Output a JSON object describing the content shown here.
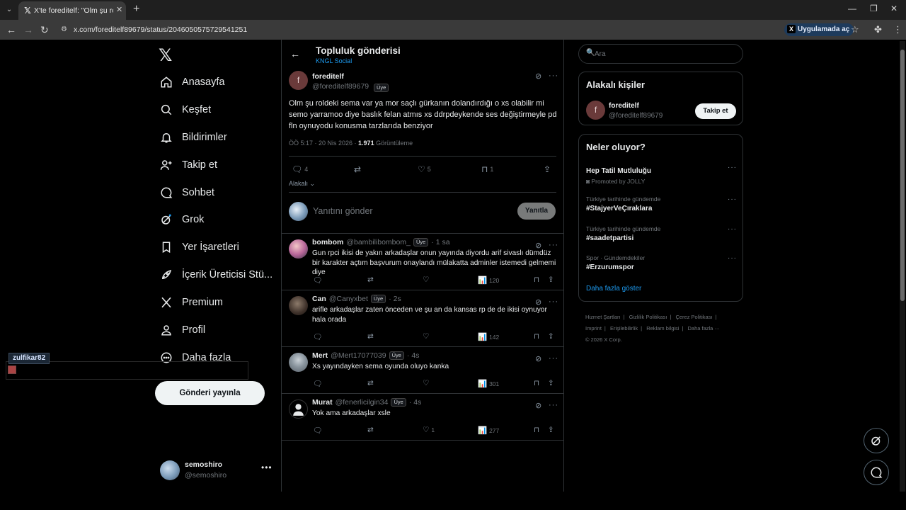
{
  "browser": {
    "tab_title": "X'te foreditelf: \"Olm şu roldeki sema var ya mor saçlı gürkanın dolandırdığı o xs olabilir mi",
    "url": "x.com/foreditelf89679/status/2046050575729541251",
    "open_in_app": "Uygulamada aç"
  },
  "nav": {
    "items": [
      {
        "label": "Anasayfa",
        "icon": "home-icon"
      },
      {
        "label": "Keşfet",
        "icon": "search-icon"
      },
      {
        "label": "Bildirimler",
        "icon": "bell-icon"
      },
      {
        "label": "Takip et",
        "icon": "add-user-icon"
      },
      {
        "label": "Sohbet",
        "icon": "chat-icon"
      },
      {
        "label": "Grok",
        "icon": "grok-icon"
      },
      {
        "label": "Yer İşaretleri",
        "icon": "bookmark-icon"
      },
      {
        "label": "İçerik Üreticisi Stü...",
        "icon": "rocket-icon"
      },
      {
        "label": "Premium",
        "icon": "x-logo-icon"
      },
      {
        "label": "Profil",
        "icon": "person-icon"
      },
      {
        "label": "Daha fazla",
        "icon": "more-circle-icon"
      }
    ],
    "post_button": "Gönderi yayınla",
    "account": {
      "name": "semoshiro",
      "handle": "@semoshiro"
    }
  },
  "overlay_username": "zulfikar82",
  "header": {
    "title": "Topluluk gönderisi",
    "community": "KNGL Social"
  },
  "post": {
    "avatar_letter": "f",
    "name": "foreditelf",
    "handle": "@foreditelf89679",
    "badge": "Üye",
    "text": "Olm şu roldeki sema var ya mor saçlı gürkanın dolandırdığı o xs olabilir mi semo yarramoo diye baslık felan atmıs xs ddrpdeykende ses değiştirmeyle pd fln oynuyodu konusma tarzlarıda benziyor",
    "time": "ÖÖ 5:17 · 20 Nis 2026 · ",
    "views": "1.971",
    "views_label": " Görüntüleme",
    "replies": "4",
    "likes": "5",
    "bookmarks": "1",
    "sort_label": "Alakalı"
  },
  "composer": {
    "placeholder": "Yanıtını gönder",
    "reply_button": "Yanıtla"
  },
  "replies": [
    {
      "name": "bombom",
      "handle": "@bambilibombom_",
      "badge": "Üye",
      "time": "· 1 sa",
      "text": "Gun rpci ikisi de yakın arkadaşlar onun yayında diyordu arif sivaslı dümdüz bir karakter açtım başvurum onaylandı mülakatta adminler istemedi gelmemi diye",
      "replies": "",
      "likes": "",
      "views": "120"
    },
    {
      "name": "Can",
      "handle": "@Canyxbet",
      "badge": "Üye",
      "time": "· 2s",
      "text": "arifle arkadaşlar zaten önceden ve şu an da kansas rp de de ikisi oynuyor hala orada",
      "replies": "",
      "likes": "",
      "views": "142"
    },
    {
      "name": "Mert",
      "handle": "@Mert17077039",
      "badge": "Üye",
      "time": "· 4s",
      "text": "Xs yayındayken sema oyunda oluyo kanka",
      "replies": "",
      "likes": "",
      "views": "301"
    },
    {
      "name": "Murat",
      "handle": "@fenerlicilgin34",
      "badge": "Üye",
      "time": "· 4s",
      "text": "Yok ama arkadaşlar xsle",
      "replies": "",
      "likes": "1",
      "views": "277"
    }
  ],
  "right": {
    "search_placeholder": "Ara",
    "relevant_title": "Alakalı kişiler",
    "relevant_person": {
      "letter": "f",
      "name": "foreditelf",
      "handle": "@foreditelf89679",
      "follow": "Takip et"
    },
    "trends_title": "Neler oluyor?",
    "trends": [
      {
        "category": "",
        "name": "Hep Tatil Mutluluğu",
        "promo": "Promoted by JOLLY"
      },
      {
        "category": "Türkiye tarihinde gündemde",
        "name": "#StajyerVeÇıraklara",
        "promo": ""
      },
      {
        "category": "Türkiye tarihinde gündemde",
        "name": "#saadetpartisi",
        "promo": ""
      },
      {
        "category": "Spor · Gündemdekiler",
        "name": "#Erzurumspor",
        "promo": ""
      }
    ],
    "show_more": "Daha fazla göster",
    "footer": [
      "Hizmet Şartları",
      "|",
      "Gizlilik Politikası",
      "|",
      "Çerez Politikası",
      "|",
      "Imprint",
      "|",
      "Erişilebilirlik",
      "|",
      "Reklam bilgisi",
      "|",
      "Daha fazla ···",
      "© 2026 X Corp."
    ]
  }
}
